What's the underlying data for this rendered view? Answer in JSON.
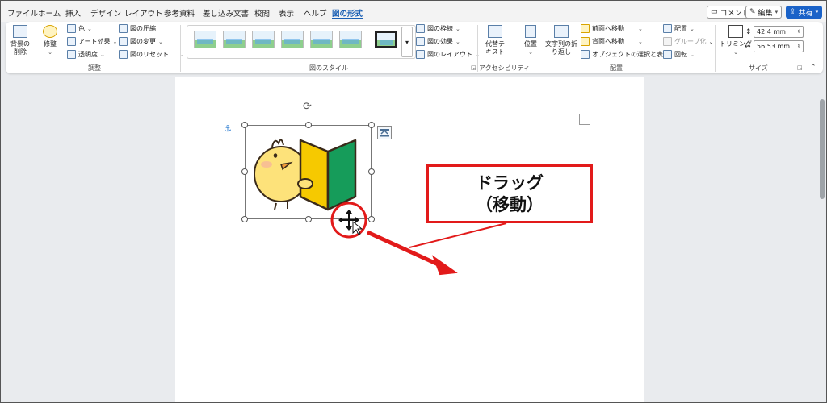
{
  "tabs": [
    "ファイル",
    "ホーム",
    "挿入",
    "デザイン",
    "レイアウト",
    "参考資料",
    "差し込み文書",
    "校閲",
    "表示",
    "ヘルプ",
    "図の形式"
  ],
  "top_buttons": {
    "comment": "コメント",
    "edit": "編集",
    "share": "共有"
  },
  "ribbon": {
    "adjust": {
      "remove_bg": [
        "背景の",
        "削除"
      ],
      "corrections": "修整",
      "color": "色",
      "art_effects": "アート効果",
      "transparency": "透明度",
      "compress": "図の圧縮",
      "change": "図の変更",
      "reset": "図のリセット",
      "label": "調整"
    },
    "styles": {
      "label": "図のスタイル",
      "border": "図の枠線",
      "effects": "図の効果",
      "layout": "図のレイアウト"
    },
    "accessibility": {
      "alt_text": [
        "代替テ",
        "キスト"
      ],
      "label": "アクセシビリティ"
    },
    "arrange": {
      "position": "位置",
      "wrap": [
        "文字列の折",
        "り返し"
      ],
      "bring_forward": "前面へ移動",
      "send_backward": "背面へ移動",
      "selection_pane": "オブジェクトの選択と表示",
      "align": "配置",
      "group": "グループ化",
      "rotate": "回転",
      "label": "配置"
    },
    "size": {
      "crop": "トリミング",
      "height": "42.4 mm",
      "width": "56.53 mm",
      "label": "サイズ"
    }
  },
  "callout": {
    "line1": "ドラッグ",
    "line2": "（移動）"
  },
  "colors": {
    "accent": "#1a5fb4",
    "annotation_red": "#e21a1a",
    "badge_yellow": "#f6c900",
    "badge_green": "#169c5a"
  }
}
